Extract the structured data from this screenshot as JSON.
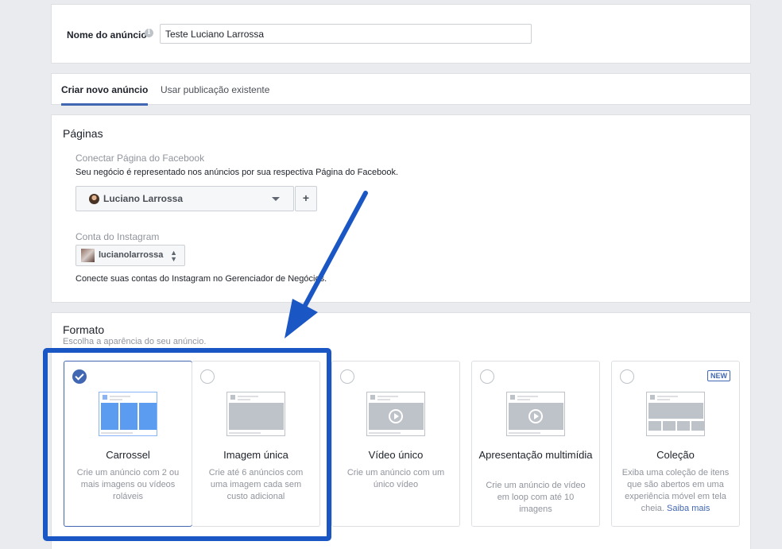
{
  "ad_name": {
    "label": "Nome do anúncio",
    "info_icon": "info-icon",
    "value": "Teste Luciano Larrossa"
  },
  "tabs": [
    {
      "label": "Criar novo anúncio",
      "active": true
    },
    {
      "label": "Usar publicação existente",
      "active": false
    }
  ],
  "pages": {
    "title": "Páginas",
    "facebook": {
      "label": "Conectar Página do Facebook",
      "description": "Seu negócio é representado nos anúncios por sua respectiva Página do Facebook.",
      "selected_page": "Luciano Larrossa",
      "add_icon": "plus-icon"
    },
    "instagram": {
      "label": "Conta do Instagram",
      "selected_account": "lucianolarrossa",
      "note": "Conecte suas contas do Instagram no Gerenciador de Negócios."
    }
  },
  "format": {
    "title": "Formato",
    "subtitle": "Escolha a aparência do seu anúncio.",
    "options": [
      {
        "title": "Carrossel",
        "description": "Crie um anúncio com 2 ou mais imagens ou vídeos roláveis",
        "selected": true
      },
      {
        "title": "Imagem única",
        "description": "Crie até 6 anúncios com uma imagem cada sem custo adicional",
        "selected": false
      },
      {
        "title": "Vídeo único",
        "description": "Crie um anúncio com um único vídeo",
        "selected": false
      },
      {
        "title": "Apresentação multimídia",
        "description": "Crie um anúncio de vídeo em loop com até 10 imagens",
        "selected": false
      },
      {
        "title": "Coleção",
        "description": "Exiba uma coleção de itens que são abertos em uma experiência móvel em tela cheia.",
        "link": "Saiba mais",
        "badge": "NEW",
        "selected": false
      }
    ]
  },
  "annotation": {
    "highlight_color": "#1a56c4",
    "arrow_color": "#1a56c4"
  },
  "colors": {
    "accent": "#4267b2",
    "background": "#e9ebee"
  }
}
